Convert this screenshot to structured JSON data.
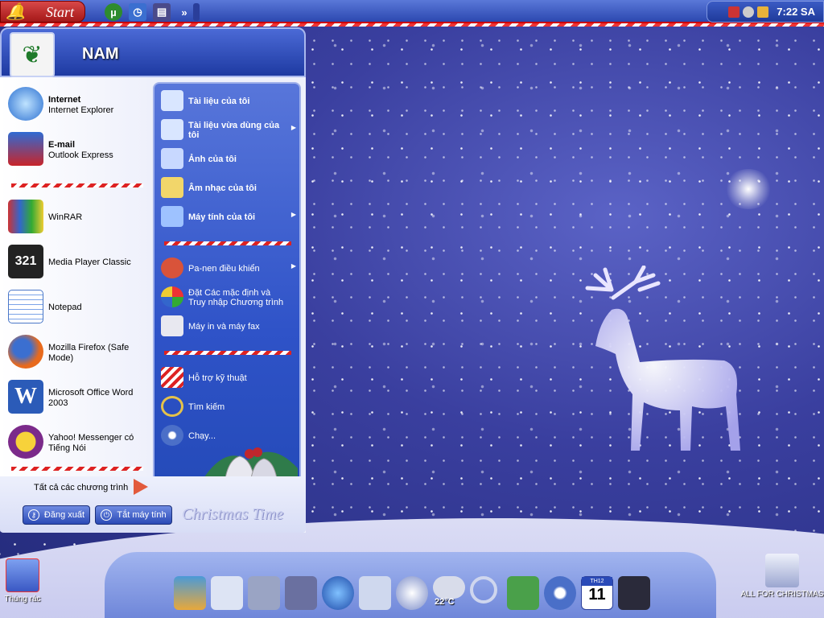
{
  "taskbar": {
    "start_label": "Start",
    "clock": "7:22 SA"
  },
  "start_menu": {
    "username": "NAM",
    "pinned": [
      {
        "title": "Internet",
        "subtitle": "Internet Explorer",
        "icon": "internet-explorer-icon"
      },
      {
        "title": "E-mail",
        "subtitle": "Outlook Express",
        "icon": "outlook-express-icon"
      }
    ],
    "recent": [
      {
        "label": "WinRAR",
        "icon": "winrar-icon"
      },
      {
        "label": "Media Player Classic",
        "icon": "media-player-classic-icon"
      },
      {
        "label": "Notepad",
        "icon": "notepad-icon"
      },
      {
        "label": "Mozilla Firefox (Safe Mode)",
        "icon": "firefox-icon"
      },
      {
        "label": "Microsoft Office Word 2003",
        "icon": "word-icon"
      },
      {
        "label": "Yahoo! Messenger có Tiếng Nói",
        "icon": "yahoo-messenger-icon"
      }
    ],
    "all_programs": "Tất cả các chương trình",
    "places": [
      {
        "label": "Tài liệu của tôi",
        "bold": true,
        "arrow": false
      },
      {
        "label": "Tài liệu vừa dùng của tôi",
        "bold": true,
        "arrow": true
      },
      {
        "label": "Ảnh của tôi",
        "bold": true,
        "arrow": false
      },
      {
        "label": "Âm nhạc của tôi",
        "bold": true,
        "arrow": false
      },
      {
        "label": "Máy tính của tôi",
        "bold": true,
        "arrow": true
      }
    ],
    "system": [
      {
        "label": "Pa-nen điều khiển",
        "arrow": true
      },
      {
        "label": "Đặt Các mặc định và Truy nhập Chương trình",
        "arrow": false
      },
      {
        "label": "Máy in và máy fax",
        "arrow": false
      }
    ],
    "tools": [
      {
        "label": "Hỗ trợ kỹ thuật"
      },
      {
        "label": "Tìm kiếm"
      },
      {
        "label": "Chạy..."
      }
    ],
    "logoff_label": "Đăng xuất",
    "shutdown_label": "Tắt máy tính",
    "decor_text": "Christmas Time"
  },
  "desktop": {
    "recycle_bin": "Thùng rác",
    "folder": "ALL FOR CHRISTMAS"
  },
  "dock": {
    "weather_temp": "22°C",
    "calendar_month": "TH12",
    "calendar_day": "11"
  }
}
